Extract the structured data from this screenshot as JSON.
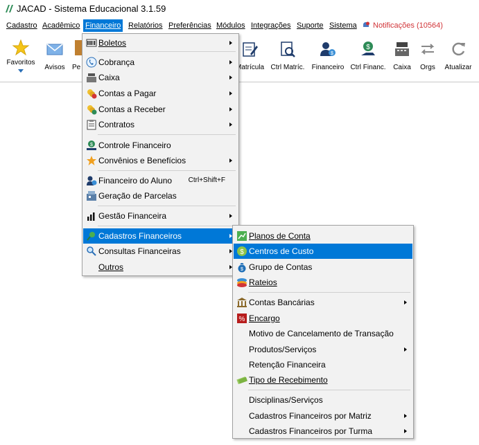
{
  "window": {
    "title": "JACAD - Sistema Educacional 3.1.59"
  },
  "menubar": {
    "items": [
      "Cadastro",
      "Acadêmico",
      "Financeiro",
      "Relatórios",
      "Preferências",
      "Módulos",
      "Integrações",
      "Suporte",
      "Sistema"
    ],
    "notifications": "Notificações (10564)"
  },
  "toolbar": {
    "items": [
      "Favoritos",
      "Avisos",
      "Pe",
      "Matrícula",
      "Ctrl Matríc.",
      "Financeiro",
      "Ctrl Financ.",
      "Caixa",
      "Orgs",
      "Atualizar"
    ]
  },
  "financeiro_menu": {
    "items": [
      {
        "label": "Boletos",
        "icon": "barcode-icon"
      },
      {
        "label": "Cobrança",
        "icon": "phone-icon"
      },
      {
        "label": "Caixa",
        "icon": "cash-register-icon"
      },
      {
        "label": "Contas a Pagar",
        "icon": "coins-minus-icon"
      },
      {
        "label": "Contas a Receber",
        "icon": "coins-plus-icon"
      },
      {
        "label": "Contratos",
        "icon": "clipboard-icon"
      },
      {
        "label": "Controle Financeiro",
        "icon": "money-hand-icon"
      },
      {
        "label": "Convênios e Benefícios",
        "icon": "star-icon"
      },
      {
        "label": "Financeiro do Aluno",
        "icon": "student-money-icon",
        "shortcut": "Ctrl+Shift+F"
      },
      {
        "label": "Geração de Parcelas",
        "icon": "parcel-icon"
      },
      {
        "label": "Gestão Financeira",
        "icon": "bar-chart-icon"
      },
      {
        "label": "Cadastros Financeiros",
        "icon": "pushpin-icon"
      },
      {
        "label": "Consultas Financeiras",
        "icon": "magnifier-icon"
      },
      {
        "label": "Outros",
        "icon": ""
      }
    ]
  },
  "cadastros_submenu": {
    "items": [
      {
        "label": "Planos de Conta",
        "icon": "chart-sheet-icon"
      },
      {
        "label": "Centros de Custo",
        "icon": "dollar-coin-icon"
      },
      {
        "label": "Grupo de Contas",
        "icon": "money-bag-icon"
      },
      {
        "label": "Rateios",
        "icon": "layers-icon"
      },
      {
        "label": "Contas Bancárias",
        "icon": "bank-icon"
      },
      {
        "label": "Encargo",
        "icon": "percent-icon"
      },
      {
        "label": "Motivo de Cancelamento de Transação",
        "icon": ""
      },
      {
        "label": "Produtos/Serviços",
        "icon": ""
      },
      {
        "label": "Retenção Financeira",
        "icon": ""
      },
      {
        "label": "Tipo de Recebimento",
        "icon": "bill-icon"
      },
      {
        "label": "Disciplinas/Serviços",
        "icon": ""
      },
      {
        "label": "Cadastros Financeiros por Matriz",
        "icon": ""
      },
      {
        "label": "Cadastros Financeiros por Turma",
        "icon": ""
      }
    ]
  }
}
